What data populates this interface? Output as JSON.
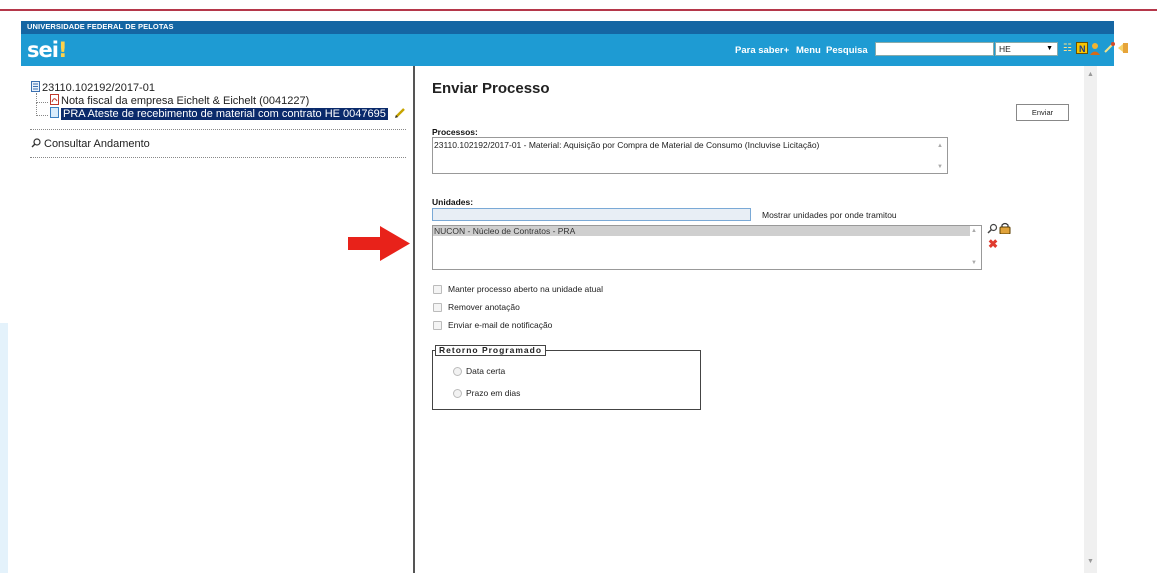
{
  "header": {
    "university": "UNIVERSIDADE FEDERAL DE PELOTAS",
    "logo": "sei",
    "logo_mark": "!",
    "links": [
      "Para saber+",
      "Menu",
      "Pesquisa"
    ],
    "search_value": "",
    "unit_selected": "HE",
    "icons": [
      "list-icon",
      "notes-icon",
      "user-icon",
      "tools-icon",
      "exit-icon"
    ]
  },
  "tree": {
    "process_number": "23110.102192/2017-01",
    "documents": [
      "Nota fiscal da empresa Eichelt & Eichelt (0041227)",
      "PRA Ateste de recebimento de material com contrato HE 0047695"
    ],
    "consultar": "Consultar Andamento"
  },
  "form": {
    "title": "Enviar Processo",
    "enviar_button": "Enviar",
    "processos_label": "Processos:",
    "processos_value": "23110.102192/2017-01 - Material: Aquisição por Compra de Material de Consumo (Incluvise Licitação)",
    "unidades_label": "Unidades:",
    "unidades_input": "",
    "mostrar_unidades": "Mostrar unidades por onde tramitou",
    "unidades_selected": "NUCON - Núcleo de Contratos - PRA",
    "checkboxes": [
      "Manter processo aberto na unidade atual",
      "Remover anotação",
      "Enviar e-mail de notificação"
    ],
    "retorno_legend": "Retorno Programado",
    "radios": [
      "Data certa",
      "Prazo em dias"
    ]
  },
  "colors": {
    "header_bg": "#1e9bd3",
    "univ_bar": "#1566a3",
    "top_line": "#b5374a",
    "selection": "#0a2a6b",
    "arrow": "#e8221a"
  }
}
